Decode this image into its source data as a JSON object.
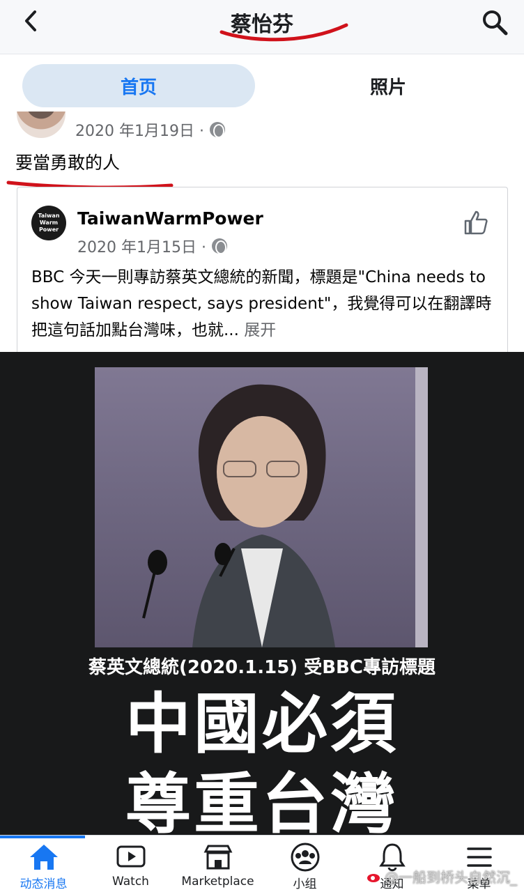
{
  "header": {
    "title": "蔡怡芬"
  },
  "tabs": [
    {
      "label": "首页"
    },
    {
      "label": "照片"
    }
  ],
  "post": {
    "date": "2020 年1月19日 ·",
    "text": "要當勇敢的人",
    "shared": {
      "avatar_text": "Taiwan Warm Power",
      "author": "TaiwanWarmPower",
      "date": "2020 年1月15日 ·",
      "body": "BBC 今天一則專訪蔡英文總統的新聞，標題是\"China needs to show Taiwan respect, says president\"，我覺得可以在翻譯時把這句話加點台灣味，也就... ",
      "more": "展开"
    },
    "image": {
      "caption": "蔡英文總統(2020.1.15) 受BBC專訪標題",
      "headline_line1": "中國必須",
      "headline_line2": "尊重台灣"
    }
  },
  "bottom_nav": [
    {
      "label": "动态消息",
      "icon": "home-icon",
      "active": true
    },
    {
      "label": "Watch",
      "icon": "watch-icon"
    },
    {
      "label": "Marketplace",
      "icon": "marketplace-icon"
    },
    {
      "label": "小组",
      "icon": "groups-icon"
    },
    {
      "label": "通知",
      "icon": "bell-icon"
    },
    {
      "label": "菜单",
      "icon": "menu-icon"
    }
  ],
  "watermark": "@一船到桥头自然沉_",
  "colors": {
    "accent": "#1877f2",
    "annotation": "#d0121b",
    "media_bg": "#18191a"
  }
}
